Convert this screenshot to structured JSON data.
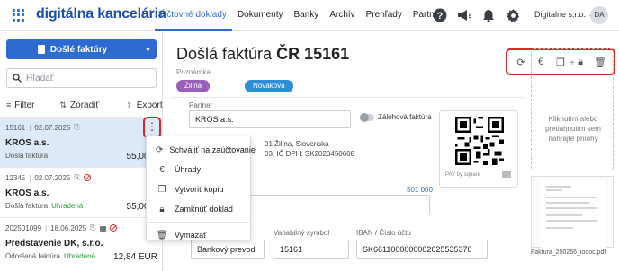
{
  "brand": "digitálna kancelária",
  "nav": [
    "Účtovné doklady",
    "Dokumenty",
    "Banky",
    "Archív",
    "Prehľady",
    "Partneri"
  ],
  "nav_active": 0,
  "header": {
    "company": "Digitalne s.r.o.",
    "avatar": "DA"
  },
  "left": {
    "new_button": "Došlé faktúry",
    "search_placeholder": "Hľadať",
    "filter": "Filter",
    "sort": "Zoradiť",
    "export": "Export",
    "items": [
      {
        "id": "15161",
        "date": "02.07.2025",
        "name": "KROS a.s.",
        "type": "Došlá faktúra",
        "status": "",
        "amount": "55,00 E"
      },
      {
        "id": "12345",
        "date": "02.07.2025",
        "name": "KROS a.s.",
        "type": "Došlá faktúra",
        "status": "Uhradená",
        "amount": "55,00 E"
      },
      {
        "id": "202501099",
        "date": "18.06.2025",
        "name": "Predstavenie DK, s.r.o.",
        "type": "Odoslaná faktúra",
        "status": "Uhradená",
        "amount": "12,84 EUR"
      }
    ]
  },
  "context_menu": [
    {
      "label": "Schváliť na zaúčtovanie",
      "icon": "approve-cycle-icon"
    },
    {
      "label": "Úhrady",
      "icon": "euro-icon"
    },
    {
      "label": "Vytvoriť kópiu",
      "icon": "copy-icon"
    },
    {
      "label": "Zamknúť doklad",
      "icon": "lock-icon"
    },
    {
      "label": "Vymazať",
      "icon": "trash-icon"
    }
  ],
  "doc": {
    "title_prefix": "Došlá faktúra",
    "title_code": "ČR",
    "title_number": "15161",
    "note": "Poznámka",
    "tags": [
      "Žilina",
      "Nováková"
    ],
    "partner_label": "Partner",
    "partner_value": "KROS a.s.",
    "advance_label": "Zálohová faktúra",
    "address_line1": "01 Žilina, Slovenská",
    "address_line2": "03, IČ DPH: SK2020450608",
    "pay_by_square": "PAY by square",
    "num_501": "501 000",
    "payment_method": "Bankový prevod",
    "vs_label": "Variabilný symbol",
    "vs_value": "15161",
    "iban_label": "IBAN / Číslo účtu",
    "iban_value": "SK6611000000002625535370"
  },
  "attachments": {
    "drop_text": "Kliknutím alebo pretiahnutím sem nahrajte prílohy",
    "file_name": "Faktura_250266_iodoc.pdf"
  }
}
